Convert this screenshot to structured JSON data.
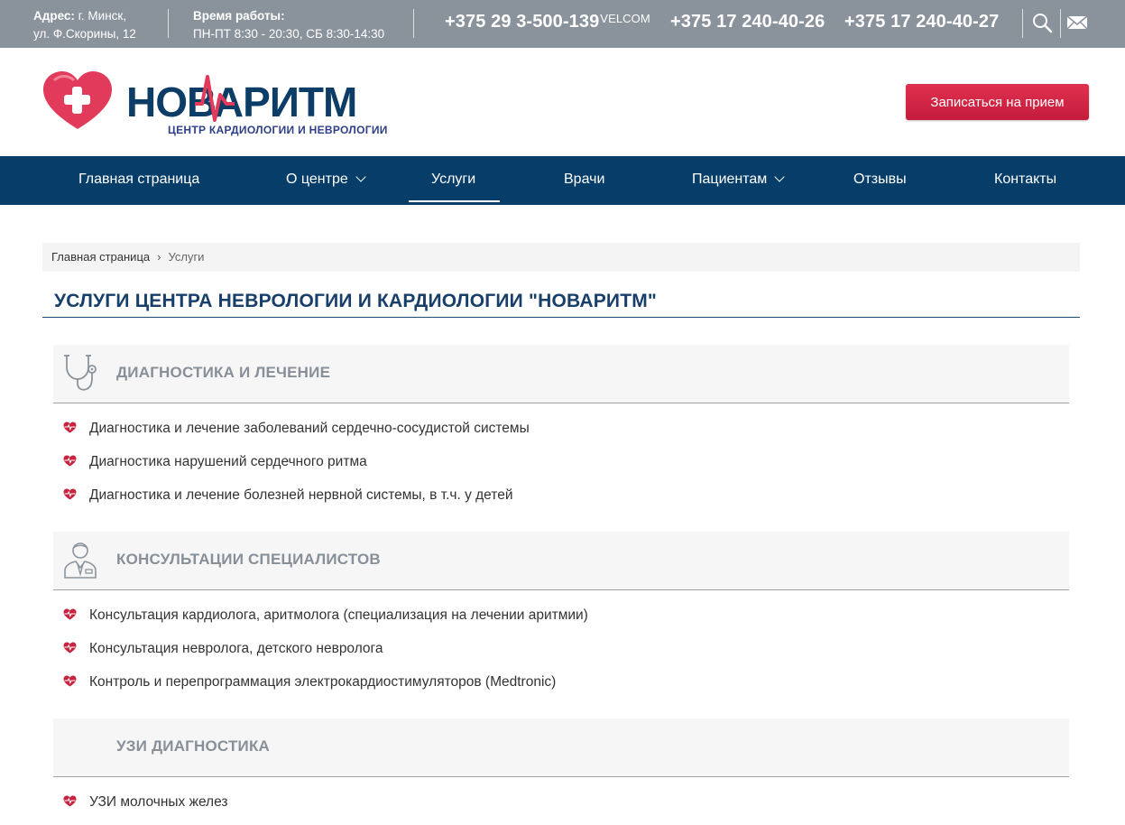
{
  "topbar": {
    "address_label": "Адрес:",
    "address_line1": " г. Минск,",
    "address_line2": "ул. Ф.Скорины, 12",
    "hours_label": "Время работы:",
    "hours_value": "ПН-ПТ 8:30 - 20:30, СБ 8:30-14:30",
    "phones": [
      {
        "number": "+375 29 3-500-139",
        "operator": "VELCOM"
      },
      {
        "number": "+375 17 240-40-26"
      },
      {
        "number": "+375 17 240-40-27"
      }
    ],
    "icons": [
      "search-icon",
      "mail-icon"
    ]
  },
  "header": {
    "logo_text": "НОВАРИТМ",
    "logo_tagline": "ЦЕНТР КАРДИОЛОГИИ И НЕВРОЛОГИИ",
    "appointment_button": "Записаться на прием"
  },
  "nav": {
    "items": [
      {
        "label": "Главная страница"
      },
      {
        "label": "О центре"
      },
      {
        "label": "Услуги"
      },
      {
        "label": "Врачи"
      },
      {
        "label": "Пациентам"
      },
      {
        "label": "Отзывы"
      },
      {
        "label": "Контакты"
      }
    ],
    "active": "Услуги"
  },
  "breadcrumb": {
    "home": "Главная страница",
    "separator": "›",
    "current": "Услуги"
  },
  "page_title": "УСЛУГИ ЦЕНТРА НЕВРОЛОГИИ И КАРДИОЛОГИИ \"НОВАРИТМ\"",
  "sections": [
    {
      "title": "ДИАГНОСТИКА И ЛЕЧЕНИЕ",
      "icon": "stethoscope-icon",
      "items": [
        "Диагностика и лечение заболеваний сердечно-сосудистой системы",
        "Диагностика нарушений сердечного ритма",
        "Диагностика и лечение болезней нервной системы, в т.ч. у детей"
      ]
    },
    {
      "title": "КОНСУЛЬТАЦИИ СПЕЦИАЛИСТОВ",
      "icon": "doctor-icon",
      "items": [
        "Консультация кардиолога, аритмолога (специализация на лечении аритмии)",
        "Консультация невролога, детского невролога",
        "Контроль и перепрограммация электрокардиостимуляторов (Medtronic)"
      ]
    },
    {
      "title": "УЗИ ДИАГНОСТИКА",
      "items": [
        "УЗИ молочных желез"
      ]
    }
  ],
  "colors": {
    "topbar": "#8a939c",
    "nav": "#063d69",
    "accent_red": "#d6264a",
    "title_blue": "#173f6a"
  }
}
